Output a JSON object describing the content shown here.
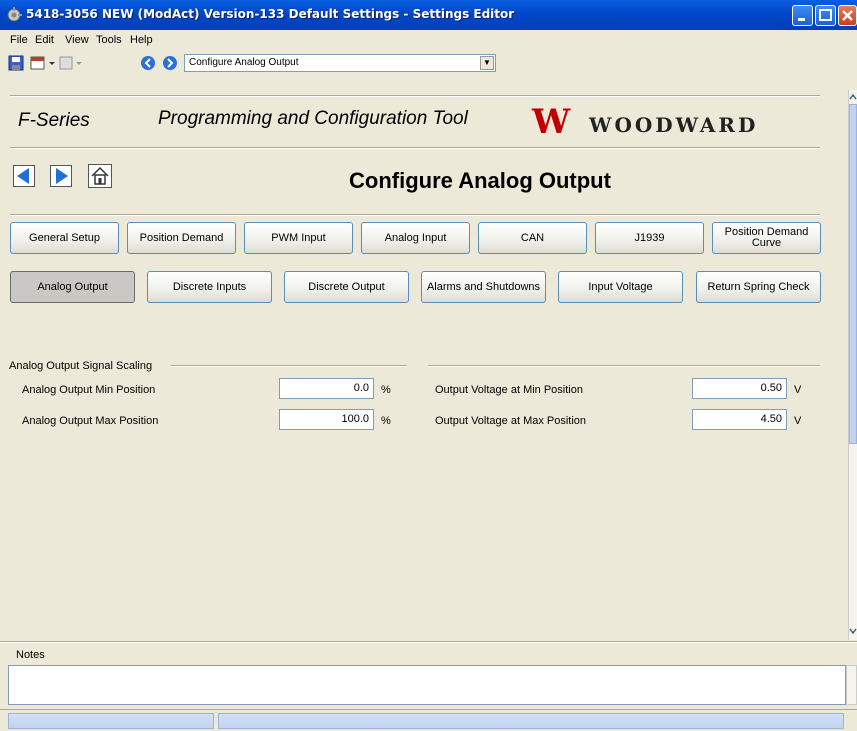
{
  "window": {
    "title": "5418-3056 NEW (ModAct) Version-133 Default Settings - Settings Editor"
  },
  "menu": {
    "items": [
      "File",
      "Edit",
      "View",
      "Tools",
      "Help"
    ]
  },
  "toolbar": {
    "page_select_value": "Configure Analog Output"
  },
  "header": {
    "series": "F-Series",
    "tool_name": "Programming and Configuration Tool",
    "brand_logo": "W",
    "brand_name": "WOODWARD"
  },
  "page_title": "Configure  Analog Output",
  "nav_buttons": {
    "row1": [
      "General Setup",
      "Position Demand",
      "PWM Input",
      "Analog Input",
      "CAN",
      "J1939",
      "Position Demand Curve"
    ],
    "row2": [
      "Analog Output",
      "Discrete Inputs",
      "Discrete Output",
      "Alarms and Shutdowns",
      "Input Voltage",
      "Return Spring Check"
    ],
    "active": "Analog Output"
  },
  "section": {
    "title": "Analog Output Signal Scaling",
    "left": [
      {
        "label": "Analog Output Min Position",
        "value": "0.0",
        "unit": "%"
      },
      {
        "label": "Analog Output Max Position",
        "value": "100.0",
        "unit": "%"
      }
    ],
    "right": [
      {
        "label": "Output Voltage at Min Position",
        "value": "0.50",
        "unit": "V"
      },
      {
        "label": "Output Voltage at Max Position",
        "value": "4.50",
        "unit": "V"
      }
    ]
  },
  "notes": {
    "label": "Notes",
    "value": ""
  },
  "colors": {
    "titlebar": "#0046C8",
    "brand_red": "#C00000",
    "active_button": "#C9C8C4",
    "nav_arrow": "#1E6FD9"
  }
}
